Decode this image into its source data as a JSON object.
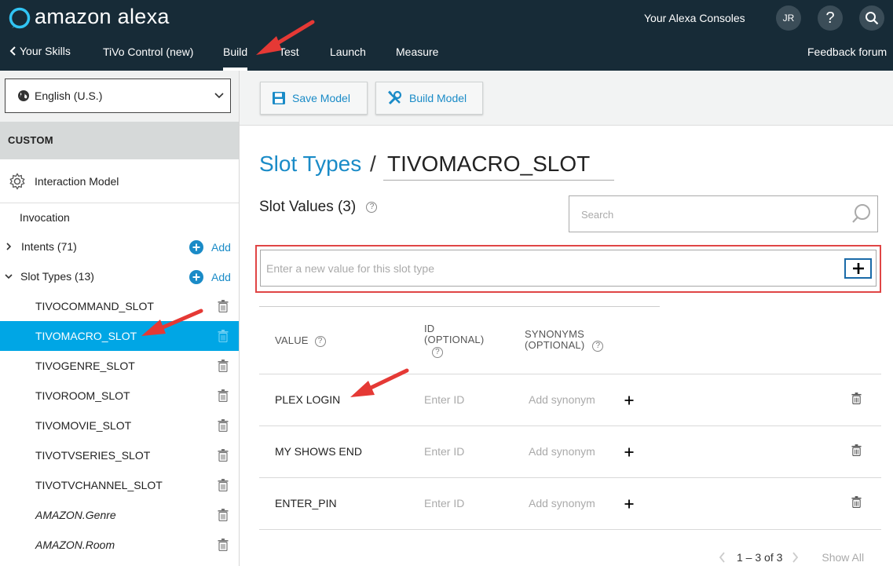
{
  "header": {
    "brand": "amazon alexa",
    "consoles_link": "Your Alexa Consoles",
    "avatar_initials": "JR",
    "help_glyph": "?",
    "back_link": "Your Skills",
    "skill_name": "TiVo Control (new)",
    "tabs": [
      {
        "label": "Build",
        "active": true
      },
      {
        "label": "Test",
        "active": false
      },
      {
        "label": "Launch",
        "active": false
      },
      {
        "label": "Measure",
        "active": false
      }
    ],
    "feedback_link": "Feedback forum"
  },
  "sidebar": {
    "language_select": "English (U.S.)",
    "section_label": "CUSTOM",
    "interaction_model": "Interaction Model",
    "invocation": "Invocation",
    "intents": {
      "label": "Intents (71)",
      "add_label": "Add"
    },
    "slot_types": {
      "label": "Slot Types (13)",
      "add_label": "Add"
    },
    "slot_items": [
      {
        "label": "TIVOCOMMAND_SLOT",
        "selected": false
      },
      {
        "label": "TIVOMACRO_SLOT",
        "selected": true
      },
      {
        "label": "TIVOGENRE_SLOT",
        "selected": false
      },
      {
        "label": "TIVOROOM_SLOT",
        "selected": false
      },
      {
        "label": "TIVOMOVIE_SLOT",
        "selected": false
      },
      {
        "label": "TIVOTVSERIES_SLOT",
        "selected": false
      },
      {
        "label": "TIVOTVCHANNEL_SLOT",
        "selected": false
      },
      {
        "label": "AMAZON.Genre",
        "selected": false
      },
      {
        "label": "AMAZON.Room",
        "selected": false
      }
    ]
  },
  "toolbar": {
    "save_label": "Save Model",
    "build_label": "Build Model"
  },
  "content": {
    "breadcrumb_link": "Slot Types",
    "breadcrumb_sep": "/",
    "slot_name": "TIVOMACRO_SLOT",
    "slot_values_heading": "Slot Values (3)",
    "search_placeholder": "Search",
    "new_value_placeholder": "Enter a new value for this slot type",
    "table": {
      "headers": {
        "value": "VALUE",
        "id_line1": "ID",
        "id_line2": "(OPTIONAL)",
        "syn_line1": "SYNONYMS",
        "syn_line2": "(OPTIONAL)"
      },
      "rows": [
        {
          "value": "PLEX LOGIN",
          "id_placeholder": "Enter ID",
          "synonym_placeholder": "Add synonym"
        },
        {
          "value": "MY SHOWS END",
          "id_placeholder": "Enter ID",
          "synonym_placeholder": "Add synonym"
        },
        {
          "value": "ENTER_PIN",
          "id_placeholder": "Enter ID",
          "synonym_placeholder": "Add synonym"
        }
      ]
    },
    "pagination": {
      "range": "1 – 3 of 3",
      "show_all": "Show All"
    }
  },
  "colors": {
    "header_bg": "#172b37",
    "accent": "#1a8bc7",
    "selected_bg": "#00a6e5",
    "annotation_red": "#e53935"
  },
  "icons": [
    "alexa-ring-icon",
    "search-icon",
    "chevron-left-icon",
    "globe-icon",
    "chevron-down-icon",
    "gear-icon",
    "chevron-right-icon",
    "plus-circle-icon",
    "trash-icon",
    "save-icon",
    "tools-icon",
    "plus-icon",
    "question-icon",
    "arrow-annotation-icon"
  ]
}
